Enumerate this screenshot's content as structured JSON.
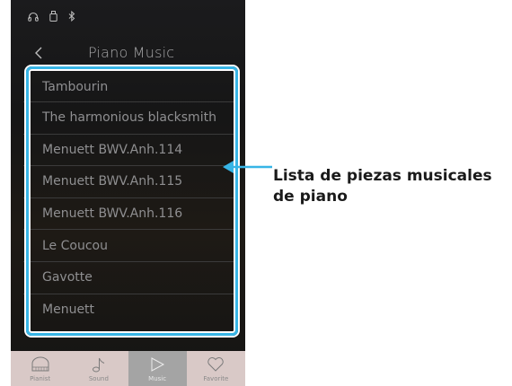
{
  "status_bar": {
    "icons": [
      "headphones-icon",
      "usb-icon",
      "bluetooth-icon"
    ]
  },
  "header": {
    "title": "Piano Music",
    "back_icon": "chevron-left-icon"
  },
  "music_list": {
    "items": [
      "Tambourin",
      "The harmonious blacksmith",
      "Menuett BWV.Anh.114",
      "Menuett BWV.Anh.115",
      "Menuett BWV.Anh.116",
      "Le Coucou",
      "Gavotte",
      "Menuett"
    ]
  },
  "bottom_nav": {
    "tabs": [
      {
        "label": "Pianist",
        "icon": "piano-icon",
        "active": false
      },
      {
        "label": "Sound",
        "icon": "music-note-icon",
        "active": false
      },
      {
        "label": "Music",
        "icon": "play-icon",
        "active": true
      },
      {
        "label": "Favorite",
        "icon": "heart-icon",
        "active": false
      }
    ]
  },
  "callout": {
    "line1": "Lista de piezas musicales",
    "line2": "de piano"
  },
  "colors": {
    "highlight_frame": "#37b5e6",
    "nav_background": "#d9c9c7",
    "nav_active": "#a4a4a4"
  }
}
